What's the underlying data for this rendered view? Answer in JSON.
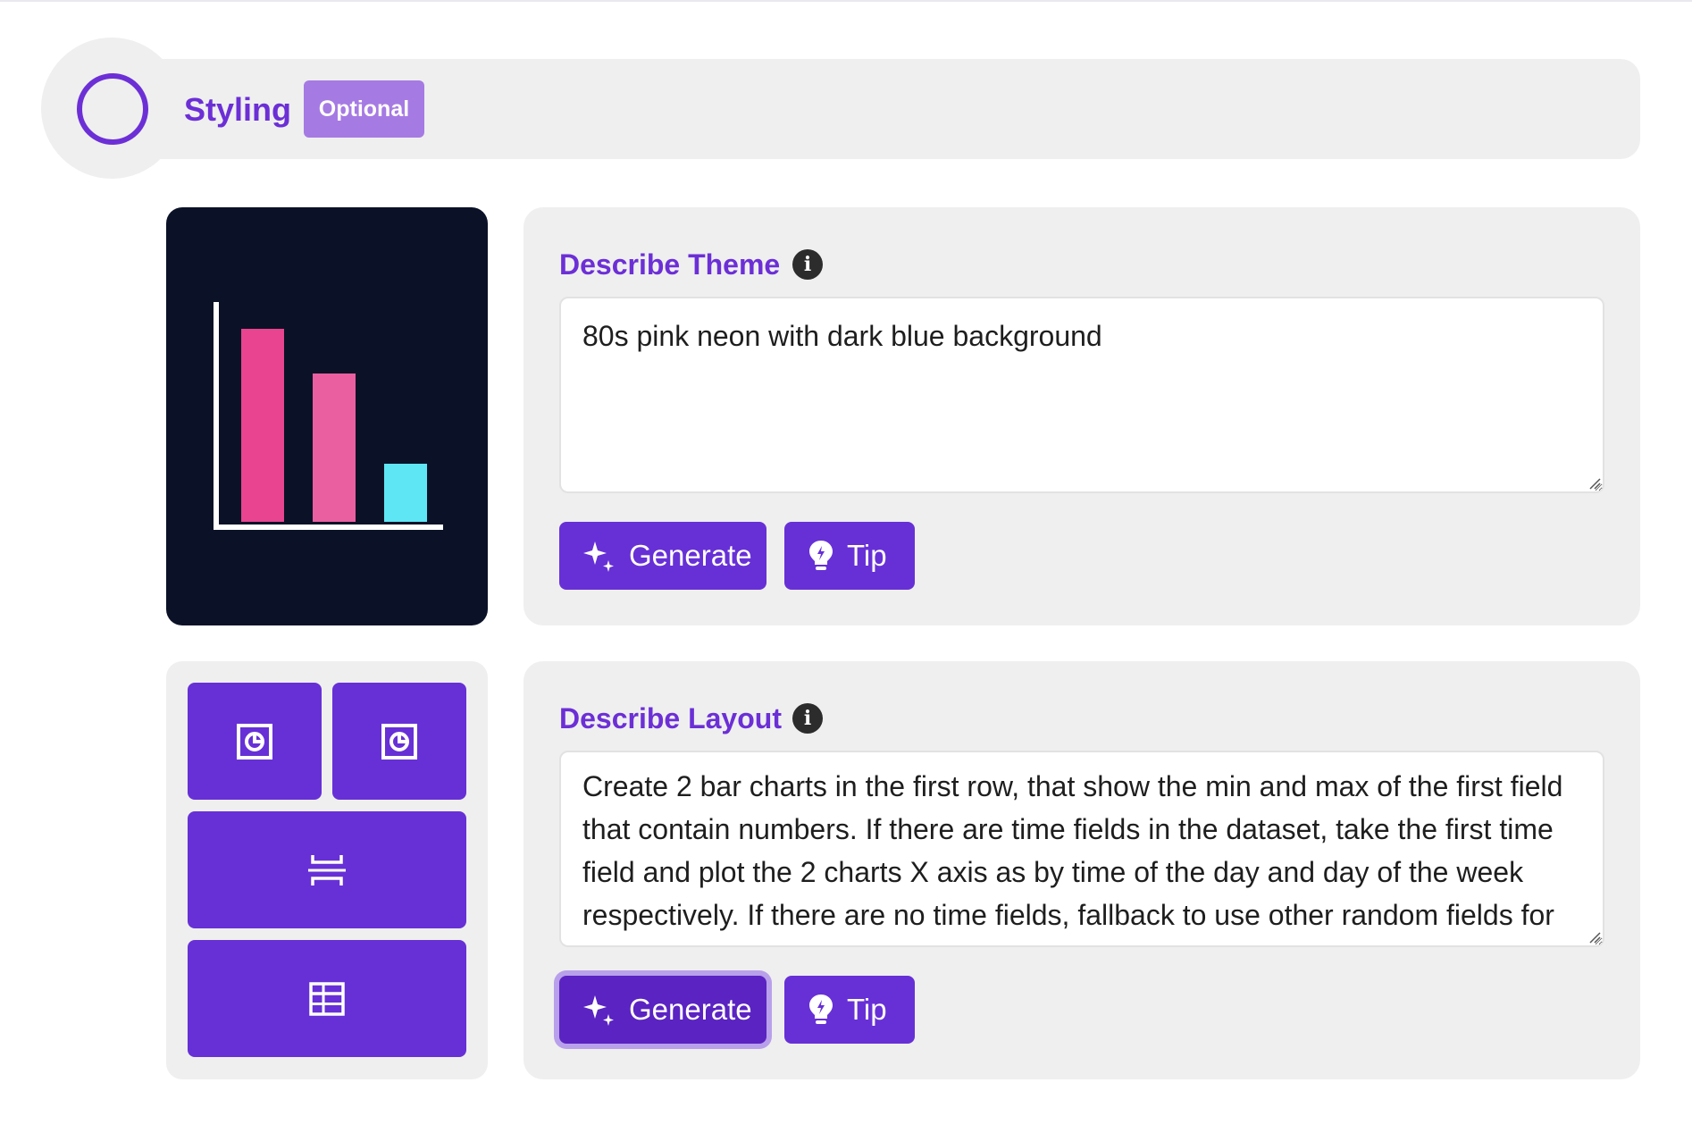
{
  "header": {
    "title": "Styling",
    "badge": "Optional"
  },
  "theme_preview": {
    "background": "#0b1228",
    "bars": [
      {
        "level": 1.0,
        "color": "#e8448f"
      },
      {
        "level": 0.77,
        "color": "#ea5fa0"
      },
      {
        "level": 0.3,
        "color": "#5fe6f5"
      }
    ],
    "axis_color": "#ffffff"
  },
  "layout_preview": {
    "cells": [
      {
        "icon": "pie-chart-icon"
      },
      {
        "icon": "pie-chart-icon"
      },
      {
        "icon": "kpi-separator-icon"
      },
      {
        "icon": "table-icon"
      }
    ]
  },
  "theme_card": {
    "title": "Describe Theme",
    "info_icon": "info-icon",
    "value": "80s pink neon with dark blue background",
    "generate_label": "Generate",
    "tip_label": "Tip"
  },
  "layout_card": {
    "title": "Describe Layout",
    "info_icon": "info-icon",
    "value": "Create 2 bar charts in the first row, that show the min and max of the first field that contain numbers. If there are time fields in the dataset, take the first time field and plot the 2 charts X axis as by time of the day and day of the week respectively. If there are no time fields, fallback to use other random fields for",
    "generate_label": "Generate",
    "tip_label": "Tip"
  },
  "colors": {
    "accent": "#6c2fd6",
    "button": "#6730d6",
    "badge": "#a67ae3",
    "panel": "#efefef"
  }
}
